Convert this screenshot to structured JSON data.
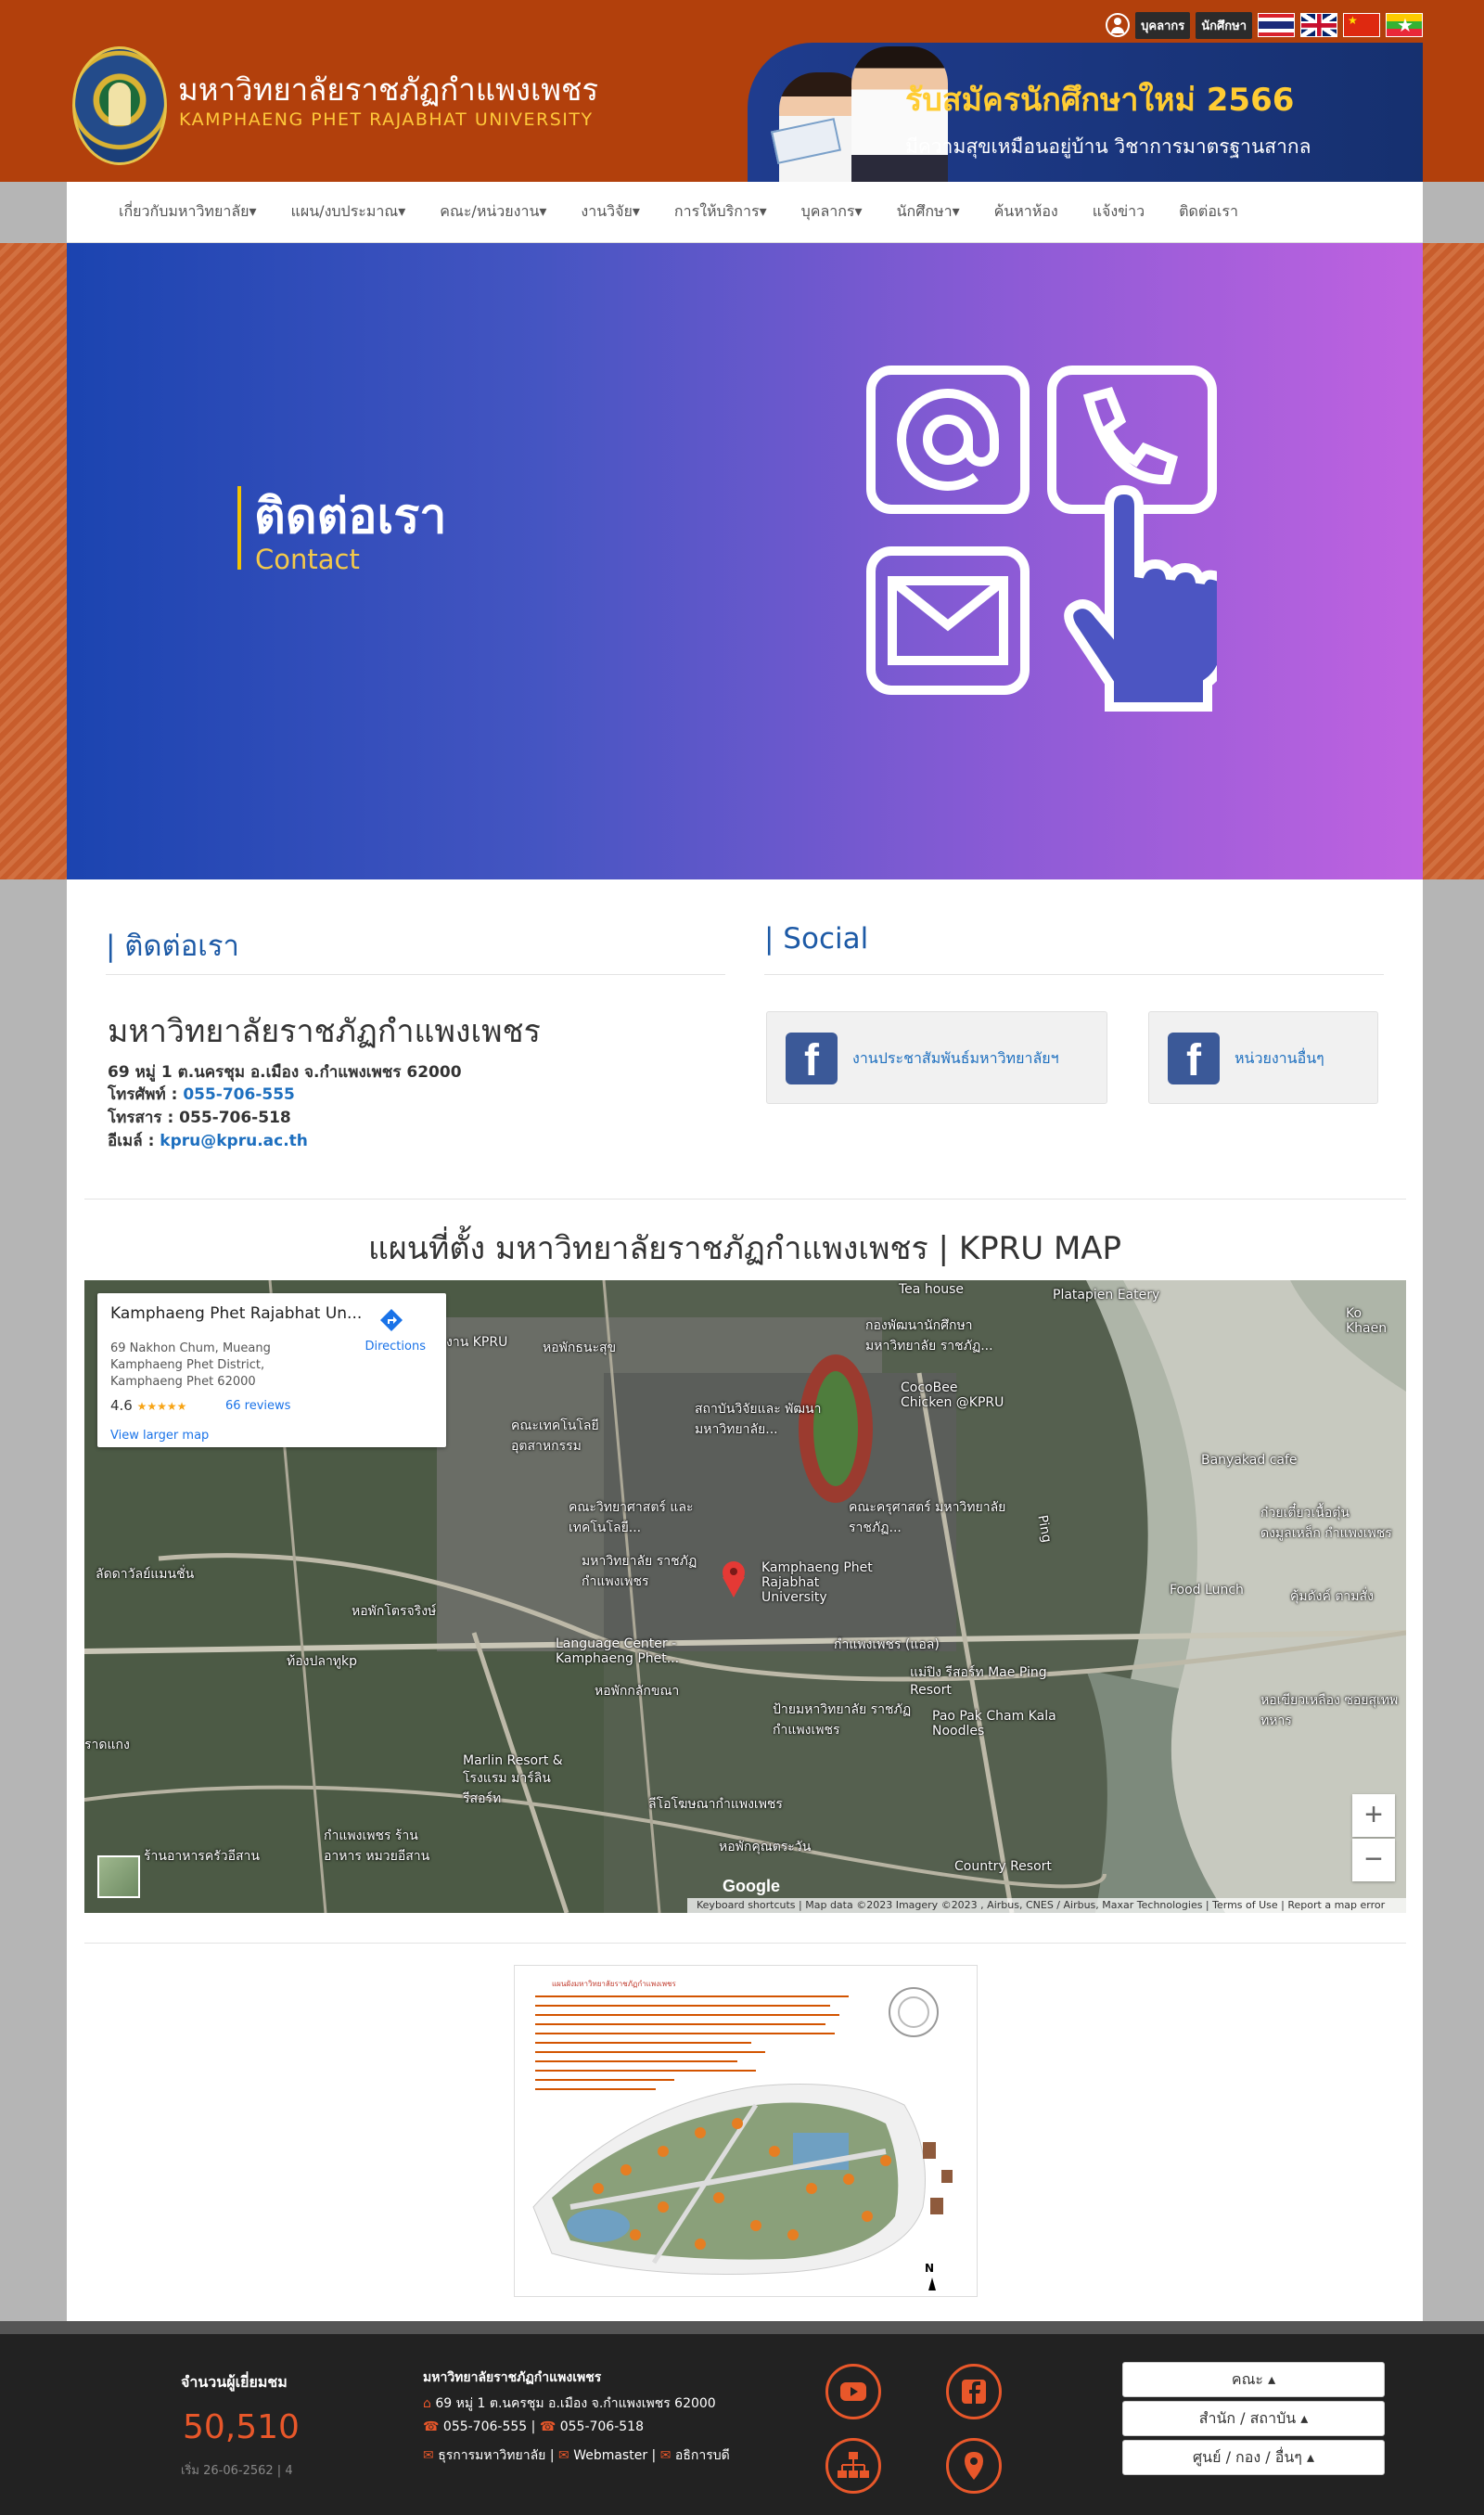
{
  "header": {
    "logo_th": "มหาวิทยาลัยราชภัฏกำแพงเพชร",
    "logo_en": "KAMPHAENG PHET RAJABHAT UNIVERSITY",
    "top_buttons": [
      "บุคลากร",
      "นักศึกษา"
    ],
    "banner_title": "รับสมัครนักศึกษาใหม่ 2566",
    "banner_sub": "มีความสุขเหมือนอยู่บ้าน วิชาการมาตรฐานสากล"
  },
  "nav": {
    "items": [
      "เกี่ยวกับมหาวิทยาลัย",
      "แผน/งบประมาณ",
      "คณะ/หน่วยงาน",
      "งานวิจัย",
      "การให้บริการ",
      "บุคลากร",
      "นักศึกษา",
      "ค้นหาห้อง",
      "แจ้งข่าว",
      "ติดต่อเรา"
    ]
  },
  "hero": {
    "title": "ติดต่อเรา",
    "subtitle": "Contact"
  },
  "contact": {
    "heading": "| ติดต่อเรา",
    "name": "มหาวิทยาลัยราชภัฏกำแพงเพชร",
    "address": "69 หมู่ 1 ต.นครชุม อ.เมือง จ.กำแพงเพชร 62000",
    "phone_label": "โทรศัพท์ : ",
    "phone": "055-706-555",
    "fax_label": "โทรสาร : ",
    "fax": "055-706-518",
    "email_label": "อีเมล์ : ",
    "email": "kpru@kpru.ac.th"
  },
  "social": {
    "heading": "| Social",
    "links": [
      "งานประชาสัมพันธ์มหาวิทยาลัยฯ",
      "หน่วยงานอื่นๆ"
    ]
  },
  "map": {
    "heading": "แผนที่ตั้ง มหาวิทยาลัยราชภัฏกำแพงเพชร | KPRU MAP",
    "card_title": "Kamphaeng Phet Rajabhat Un...",
    "card_address": [
      "69 Nakhon Chum, Mueang",
      "Kamphaeng Phet District,",
      "Kamphaeng Phet 62000"
    ],
    "directions": "Directions",
    "rating": "4.6",
    "stars": "★★★★★",
    "reviews": "66 reviews",
    "larger": "View larger map",
    "zoom_in": "+",
    "zoom_out": "−",
    "google": "Google",
    "footer_text": "Keyboard shortcuts   |   Map data ©2023 Imagery ©2023 , Airbus, CNES / Airbus, Maxar Technologies   |   Terms of Use   |   Report a map error",
    "labels": [
      {
        "text": "Tea house"
      },
      {
        "text": "Platapien Eatery"
      },
      {
        "text": "Ko Khaen"
      },
      {
        "text": "กองพัฒนานักศึกษา มหาวิทยาลัย ราชภัฏ..."
      },
      {
        "text": "งาน KPRU"
      },
      {
        "text": "หอพักธนะสุข"
      },
      {
        "text": "CocoBee Chicken @KPRU"
      },
      {
        "text": "คณะเทคโนโลยี อุตสาหกรรม"
      },
      {
        "text": "สถาบันวิจัยและ พัฒนา มหาวิทยาลัย..."
      },
      {
        "text": "Banyakad cafe"
      },
      {
        "text": "คณะวิทยาศาสตร์ และเทคโนโลยี..."
      },
      {
        "text": "คณะครุศาสตร์ มหาวิทยาลัย ราชภัฏ..."
      },
      {
        "text": "ก๋วยเตี๋ยวเนื้อตุ๋น ดงมูลเหล็ก กำแพงเพชร"
      },
      {
        "text": "ลัดดาวัลย์แมนชั่น"
      },
      {
        "text": "มหาวิทยาลัย ราชภัฏกำแพงเพชร"
      },
      {
        "text": "Kamphaeng Phet Rajabhat University"
      },
      {
        "text": "Food Lunch"
      },
      {
        "text": "คุ้มดังค์ ตามสั่ง"
      },
      {
        "text": "หอพักโตรจริงษ์"
      },
      {
        "text": "ท้องปลาทูkp"
      },
      {
        "text": "Language Center - Kamphaeng Phet..."
      },
      {
        "text": "กำแพงเพชร (แอล)"
      },
      {
        "text": "แม่ปิง รีสอร์ท Mae Ping Resort"
      },
      {
        "text": "หอพักกลักขณา"
      },
      {
        "text": "ป้ายมหาวิทยาลัย ราชภัฏกำแพงเพชร"
      },
      {
        "text": "Pao Pak Cham Kala Noodles"
      },
      {
        "text": "หอเขียวเหลือง ซอยสุเทพทหาร"
      },
      {
        "text": "ราดแกง"
      },
      {
        "text": "Marlin Resort & โรงแรม มาร์ลิน รีสอร์ท"
      },
      {
        "text": "ลีโอโฆษณากำแพงเพชร"
      },
      {
        "text": "กำแพงเพชร ร้าน อาหาร หมวยอีสาน"
      },
      {
        "text": "ร้านอาหารครัวอีสาน"
      },
      {
        "text": "หอพักคุณตระวัน"
      },
      {
        "text": "Country Resort"
      },
      {
        "text": "Ping"
      }
    ]
  },
  "campus_map": {
    "title": "แผนผังมหาวิทยาลัยราชภัฏกำแพงเพชร",
    "north": "N"
  },
  "footer": {
    "visit_label": "จำนวนผู้เยี่ยมชม",
    "visit_count": "50,510",
    "visit_since": "เริ่ม 26-06-2562 | 4",
    "name": "มหาวิทยาลัยราชภัฏกำแพงเพชร",
    "address": "69 หมู่ 1 ต.นครชุม อ.เมือง จ.กำแพงเพชร 62000",
    "phone": "055-706-555",
    "fax": "055-706-518",
    "mail_links": [
      "ธุรการมหาวิทยาลัย",
      "Webmaster",
      "อธิการบดี"
    ],
    "dropdowns": [
      "คณะ",
      "สำนัก / สถาบัน",
      "ศูนย์ / กอง / อื่นๆ"
    ]
  },
  "colors": {
    "header_bg": "#b2400c",
    "accent_orange": "#e8572a",
    "link_blue": "#1d6fbf",
    "hero_left": "#1b44b0",
    "hero_right": "#c062e0",
    "footer_bg": "#222222"
  }
}
